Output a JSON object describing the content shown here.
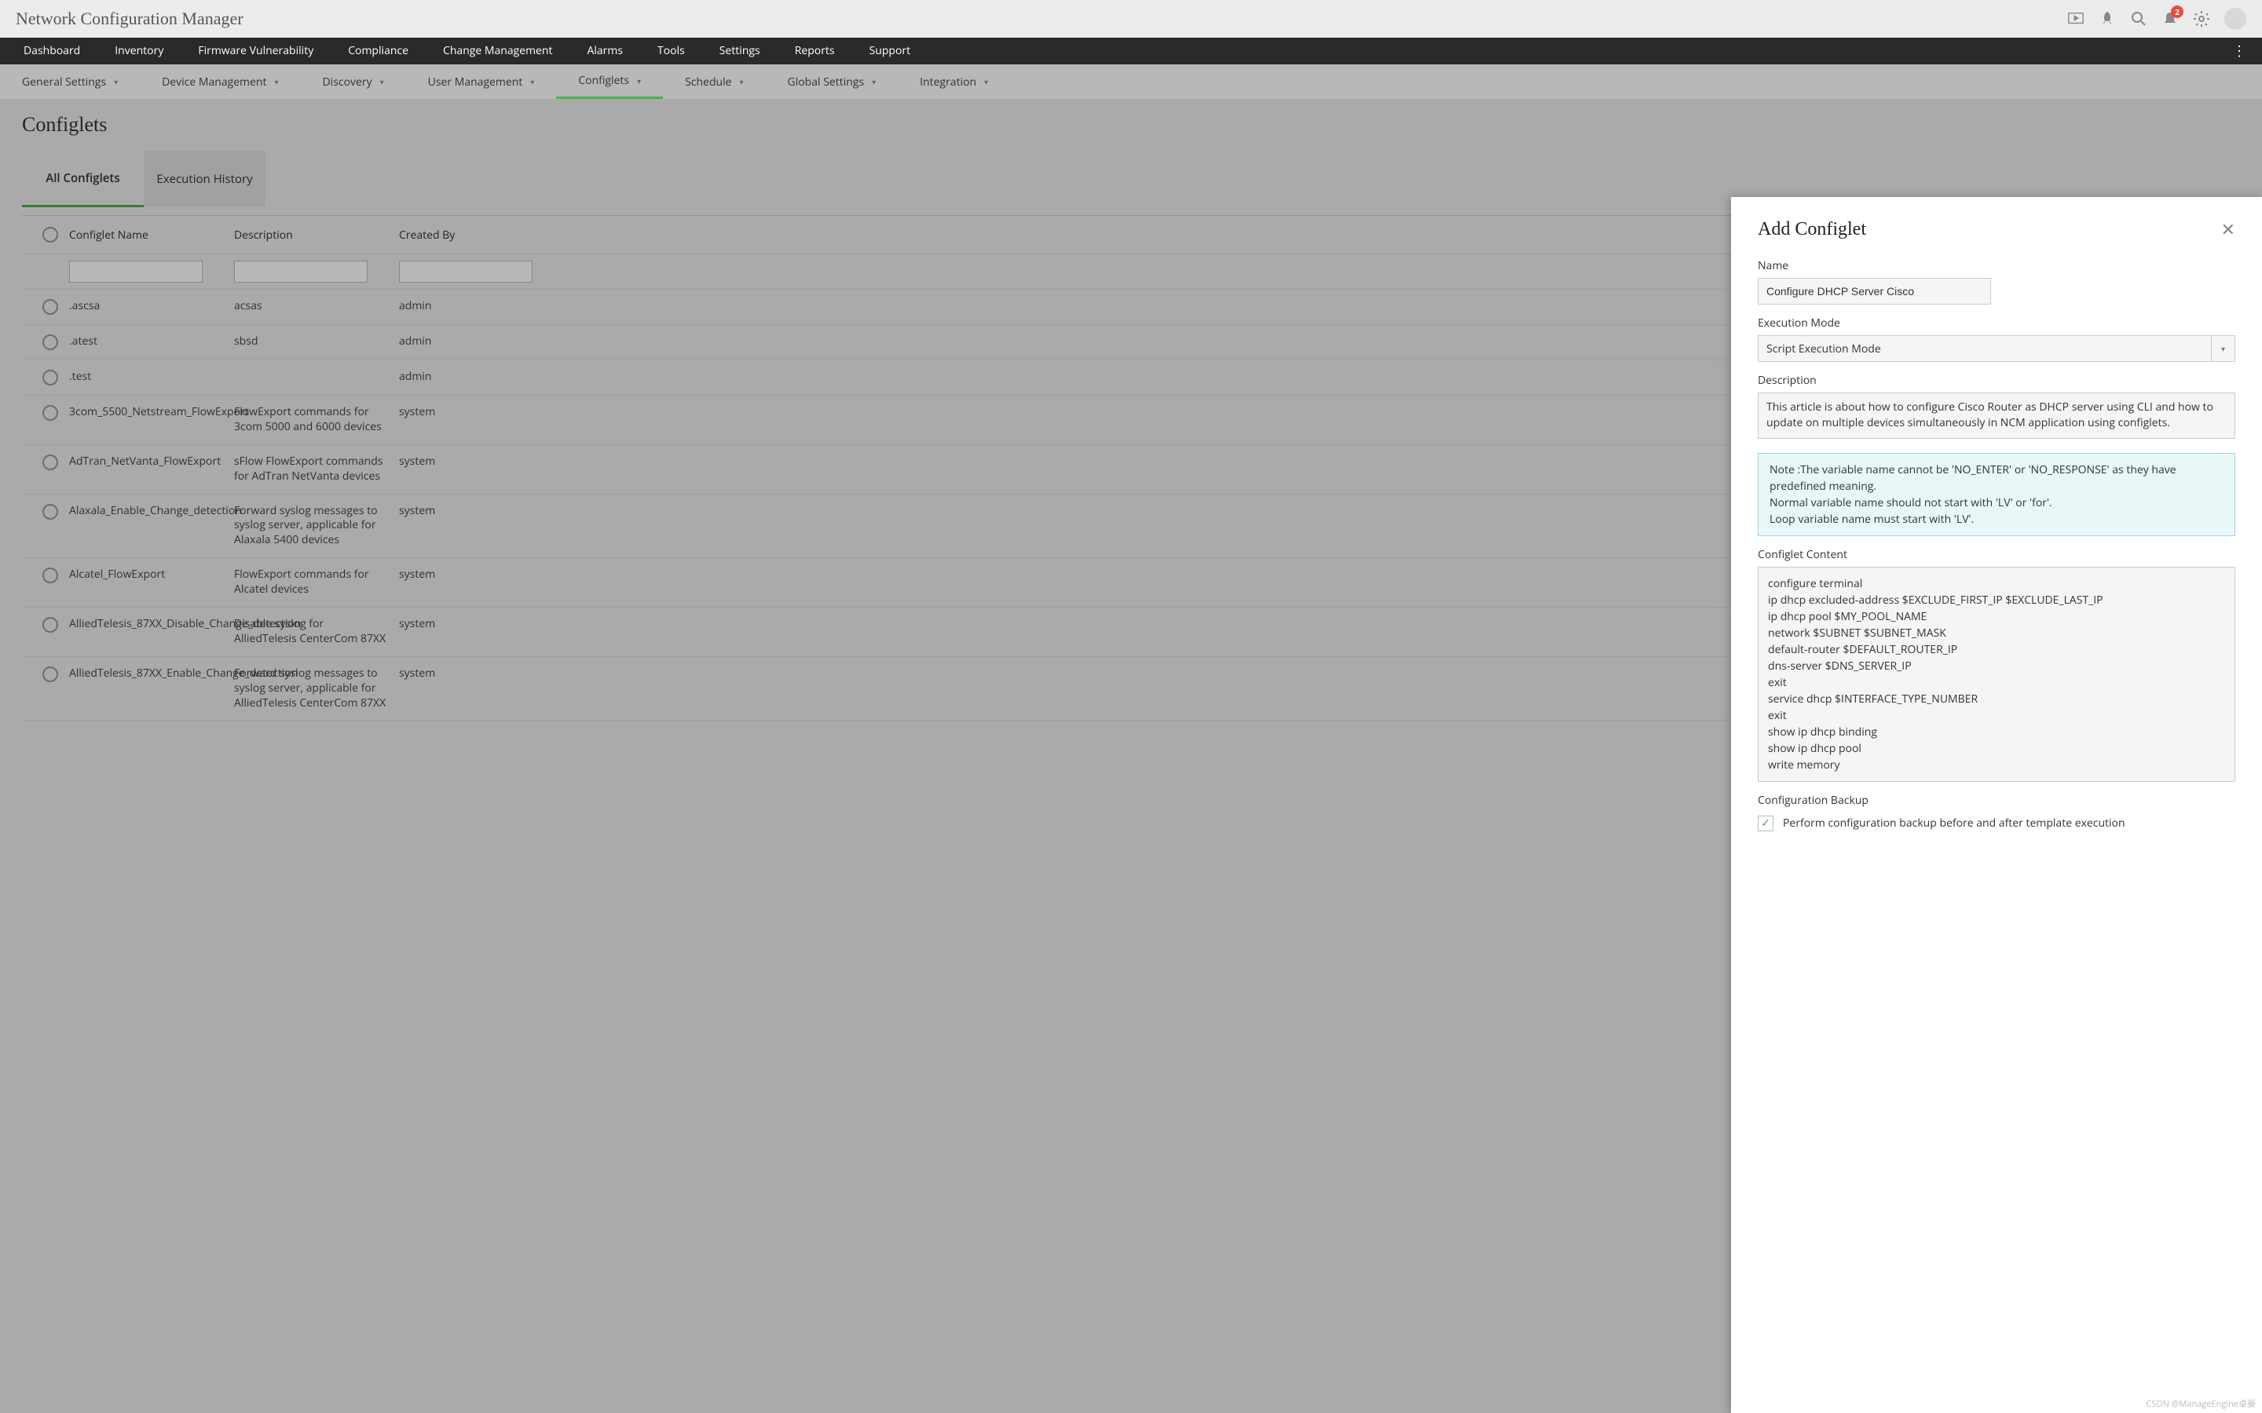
{
  "app_title": "Network Configuration Manager",
  "notification_count": "2",
  "main_nav": [
    "Dashboard",
    "Inventory",
    "Firmware Vulnerability",
    "Compliance",
    "Change Management",
    "Alarms",
    "Tools",
    "Settings",
    "Reports",
    "Support"
  ],
  "sub_nav": [
    "General Settings",
    "Device Management",
    "Discovery",
    "User Management",
    "Configlets",
    "Schedule",
    "Global Settings",
    "Integration"
  ],
  "sub_nav_active_index": 4,
  "page_title": "Configlets",
  "tabs": {
    "all": "All Configlets",
    "history": "Execution History"
  },
  "table": {
    "headers": {
      "name": "Configlet Name",
      "desc": "Description",
      "by": "Created By"
    },
    "rows": [
      {
        "name": ".ascsa",
        "desc": "acsas",
        "by": "admin"
      },
      {
        "name": ".atest",
        "desc": "sbsd",
        "by": "admin"
      },
      {
        "name": ".test",
        "desc": "",
        "by": "admin"
      },
      {
        "name": "3com_5500_Netstream_FlowExport",
        "desc": "FlowExport commands for 3com 5000 and 6000 devices",
        "by": "system"
      },
      {
        "name": "AdTran_NetVanta_FlowExport",
        "desc": "sFlow FlowExport commands for AdTran NetVanta devices",
        "by": "system"
      },
      {
        "name": "Alaxala_Enable_Change_detection",
        "desc": "Forward syslog messages to syslog server, applicable for Alaxala 5400 devices",
        "by": "system"
      },
      {
        "name": "Alcatel_FlowExport",
        "desc": "FlowExport commands for Alcatel devices",
        "by": "system"
      },
      {
        "name": "AlliedTelesis_87XX_Disable_Change_detection",
        "desc": "Disable syslog for AlliedTelesis CenterCom 87XX",
        "by": "system"
      },
      {
        "name": "AlliedTelesis_87XX_Enable_Change_detection",
        "desc": "Forward syslog messages to syslog server, applicable for AlliedTelesis CenterCom 87XX",
        "by": "system"
      }
    ]
  },
  "drawer": {
    "title": "Add Configlet",
    "name_label": "Name",
    "name_value": "Configure DHCP Server Cisco",
    "mode_label": "Execution Mode",
    "mode_value": "Script Execution Mode",
    "desc_label": "Description",
    "desc_value": "This article is about how to configure Cisco Router as DHCP server using CLI and how to update on multiple devices simultaneously in NCM application using configlets.",
    "note_line1": "Note :The variable name cannot be 'NO_ENTER' or 'NO_RESPONSE' as they have predefined meaning.",
    "note_line2": "Normal variable name should not start with 'LV' or 'for'.",
    "note_line3": "Loop variable name must start with 'LV'.",
    "content_label": "Configlet Content",
    "content_value": "configure terminal\nip dhcp excluded-address $EXCLUDE_FIRST_IP $EXCLUDE_LAST_IP\nip dhcp pool $MY_POOL_NAME\nnetwork $SUBNET $SUBNET_MASK\ndefault-router $DEFAULT_ROUTER_IP\ndns-server $DNS_SERVER_IP\nexit\nservice dhcp $INTERFACE_TYPE_NUMBER\nexit\nshow ip dhcp binding\nshow ip dhcp pool\nwrite memory",
    "backup_label": "Configuration Backup",
    "backup_checkbox": "Perform configuration backup before and after template execution"
  },
  "watermark": "CSDN @ManageEngine卓豪"
}
